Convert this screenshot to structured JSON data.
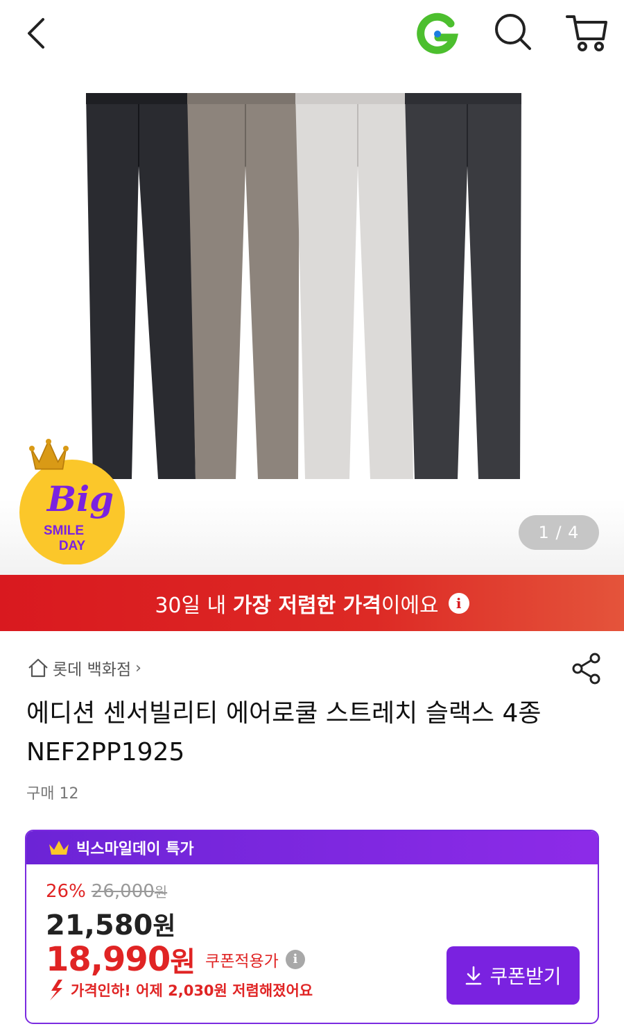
{
  "header": {
    "back_icon": "chevron-left-icon",
    "logo_icon": "g-logo-icon",
    "search_icon": "search-icon",
    "cart_icon": "cart-icon"
  },
  "hero": {
    "pager": "1 / 4",
    "badge": {
      "big": "Big",
      "smile": "SMILE",
      "day": "DAY"
    }
  },
  "lowest_banner": {
    "pre": "30일 내 ",
    "bold": "가장 저렴한 가격",
    "post": "이에요",
    "info": "i"
  },
  "store": {
    "name": "롯데 백화점",
    "chevron": "›"
  },
  "product": {
    "title": "에디션 센서빌리티 에어로쿨 스트레치 슬랙스 4종 NEF2PP1925",
    "purchase_count": "구매 12"
  },
  "deal": {
    "header": "빅스마일데이 특가",
    "discount_pct": "26%",
    "original_price": "26,000",
    "original_unit": "원",
    "sale_price": "21,580",
    "sale_unit": "원",
    "coupon_price": "18,990",
    "coupon_unit": "원",
    "coupon_label": "쿠폰적용가",
    "price_drop": "가격인하! 어제 2,030원 저렴해졌어요",
    "coupon_button": "쿠폰받기"
  },
  "colors": {
    "accent_red": "#d9191f",
    "accent_purple": "#7a22e0",
    "logo_green": "#4cbf2e",
    "logo_blue": "#1b7ee0"
  }
}
